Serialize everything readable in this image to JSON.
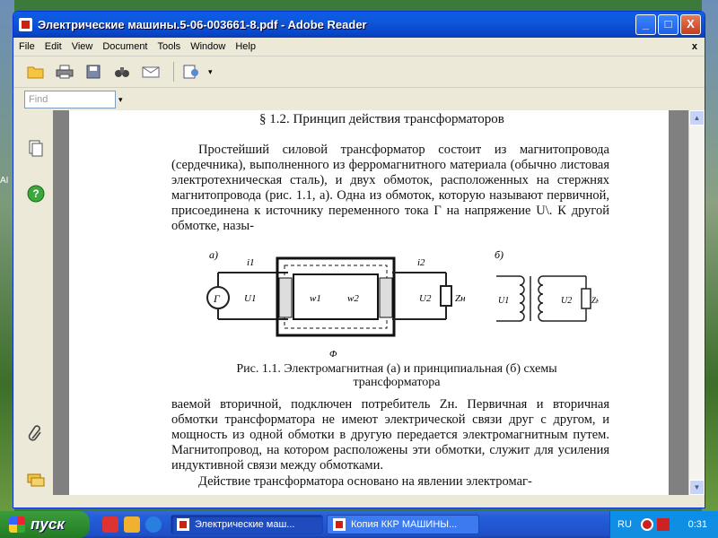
{
  "window": {
    "title": "Электрические машины.5-06-003661-8.pdf - Adobe Reader",
    "min_label": "_",
    "max_label": "□",
    "close_label": "X"
  },
  "menu": {
    "items": [
      "File",
      "Edit",
      "View",
      "Document",
      "Tools",
      "Window",
      "Help"
    ],
    "close_doc": "x"
  },
  "toolbar": {
    "tools": [
      "open-folder-icon",
      "print-icon",
      "save-icon",
      "find-binoculars-icon",
      "email-icon",
      "review-comment-icon"
    ]
  },
  "find": {
    "placeholder": "Find",
    "dropdown": "▾"
  },
  "document": {
    "heading": "§ 1.2. Принцип действия трансформаторов",
    "para1": "Простейший силовой трансформатор состоит из магнитопровода (сердечника), выполненного из ферромагнитного материала (обычно листовая электротехническая сталь), и двух обмоток, расположенных на стержнях магнитопровода (рис. 1.1, а). Одна из обмоток, которую называют первичной, присоединена к источнику переменного тока Г на напряжение U\\. К другой обмотке, назы-",
    "caption_line1": "Рис. 1.1. Электромагнитная (а) и принципиальная (б) схемы",
    "caption_line2": "трансформатора",
    "para2": "ваемой вторичной, подключен потребитель Zн. Первичная и вторичная обмотки трансформатора не имеют электрической связи друг с другом, и мощность из одной обмотки в другую передается электромагнитным путем. Магнитопровод, на котором расположены эти обмотки, служит для усиления индуктивной связи между обмотками.",
    "para3_partial": "Действие трансформатора основано на явлении электромаг-",
    "figure_a": {
      "label": "а)",
      "generator": "Г",
      "i1": "i1",
      "i2": "i2",
      "u1": "U1",
      "u2": "U2",
      "w1": "w1",
      "w2": "w2",
      "zn": "Zн",
      "phi": "Φ"
    },
    "figure_b": {
      "label": "б)",
      "u1": "U1",
      "u2": "U2",
      "zn": "Zн"
    }
  },
  "scroll": {
    "up": "▲",
    "down": "▼"
  },
  "taskbar": {
    "start_label": "пуск",
    "tasks": [
      "Электрические маш...",
      "Копия ККР МАШИНЫ..."
    ],
    "lang": "RU",
    "clock": "0:31"
  },
  "colors": {
    "titlebar": "#0a5ee8",
    "taskbar": "#245edb",
    "start": "#2f8d2f",
    "page": "#ffffff"
  }
}
